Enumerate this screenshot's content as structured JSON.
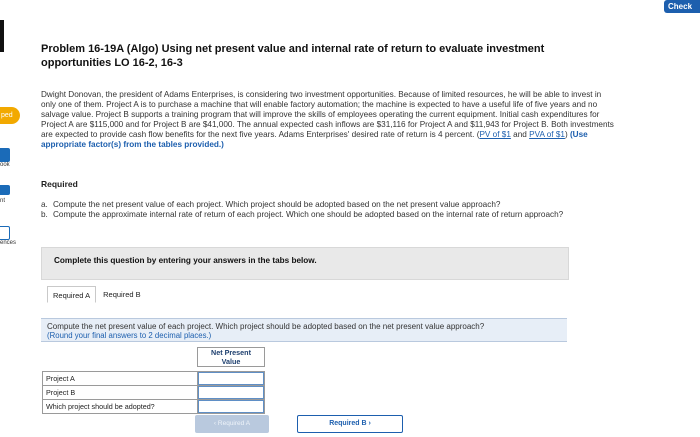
{
  "header": {
    "check_label": "Check"
  },
  "sidebar": {
    "items": [
      {
        "label": "ped"
      },
      {
        "label": "ook"
      },
      {
        "label": "nt"
      },
      {
        "label": "ences"
      }
    ]
  },
  "problem": {
    "title": "Problem 16-19A (Algo) Using net present value and internal rate of return to evaluate investment opportunities LO 16-2, 16-3",
    "body": "Dwight Donovan, the president of Adams Enterprises, is considering two investment opportunities. Because of limited resources, he will be able to invest in only one of them. Project A is to purchase a machine that will enable factory automation; the machine is expected to have a useful life of five years and no salvage value. Project B supports a training program that will improve the skills of employees operating the current equipment. Initial cash expenditures for Project A are $115,000 and for Project B are $41,000. The annual expected cash inflows are $31,116 for Project A and $11,943 for Project B. Both investments are expected to provide cash flow benefits for the next five years. Adams Enterprises' desired rate of return is 4 percent.",
    "link_pv": "PV of $1",
    "link_and": "and",
    "link_pva": "PVA of $1",
    "hint": "(Use appropriate factor(s) from the tables provided.)",
    "required_heading": "Required",
    "requirements": [
      {
        "key": "a.",
        "text": "Compute the net present value of each project. Which project should be adopted based on the net present value approach?"
      },
      {
        "key": "b.",
        "text": "Compute the approximate internal rate of return of each project. Which one should be adopted based on the internal rate of return approach?"
      }
    ]
  },
  "instruction_box": {
    "text": "Complete this question by entering your answers in the tabs below."
  },
  "tabs": [
    {
      "label": "Required A"
    },
    {
      "label": "Required B"
    }
  ],
  "banner": {
    "line1": "Compute the net present value of each project. Which project should be adopted based on the net present value approach?",
    "line2": "(Round your final answers to 2 decimal places.)"
  },
  "table": {
    "column_header": "Net Present Value",
    "rows": [
      {
        "label": "Project A",
        "value": ""
      },
      {
        "label": "Project B",
        "value": ""
      },
      {
        "label": "Which project should be adopted?",
        "value": ""
      }
    ]
  },
  "nav": {
    "prev_label": "‹  Required A",
    "next_label": "Required B  ›"
  },
  "colors": {
    "accent": "#1d5fae",
    "badge": "#f2a900",
    "banner_bg": "#e7eef7"
  }
}
